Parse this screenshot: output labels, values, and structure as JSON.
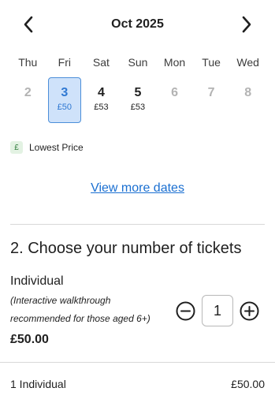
{
  "calendar": {
    "month_label": "Oct 2025",
    "weekdays": [
      "Thu",
      "Fri",
      "Sat",
      "Sun",
      "Mon",
      "Tue",
      "Wed"
    ],
    "days": [
      {
        "num": "2",
        "price": "",
        "state": "disabled"
      },
      {
        "num": "3",
        "price": "£50",
        "state": "selected"
      },
      {
        "num": "4",
        "price": "£53",
        "state": "available"
      },
      {
        "num": "5",
        "price": "£53",
        "state": "available"
      },
      {
        "num": "6",
        "price": "",
        "state": "disabled"
      },
      {
        "num": "7",
        "price": "",
        "state": "disabled"
      },
      {
        "num": "8",
        "price": "",
        "state": "disabled"
      }
    ]
  },
  "legend": {
    "icon": "£",
    "label": "Lowest Price"
  },
  "more_dates": {
    "label": "View more dates"
  },
  "tickets": {
    "section_title": "2. Choose your number of tickets",
    "type_name": "Individual",
    "note": "(Interactive walkthrough recommended for those aged 6+)",
    "price": "£50.00",
    "quantity": "1"
  },
  "summary": {
    "label": "1 Individual",
    "amount": "£50.00"
  },
  "colors": {
    "accent": "#1a6fd1",
    "selected_bg": "#cfe2fa",
    "selected_text": "#2f78d2",
    "legend_bg": "#e3f2e3",
    "legend_text": "#2d7a3a"
  }
}
